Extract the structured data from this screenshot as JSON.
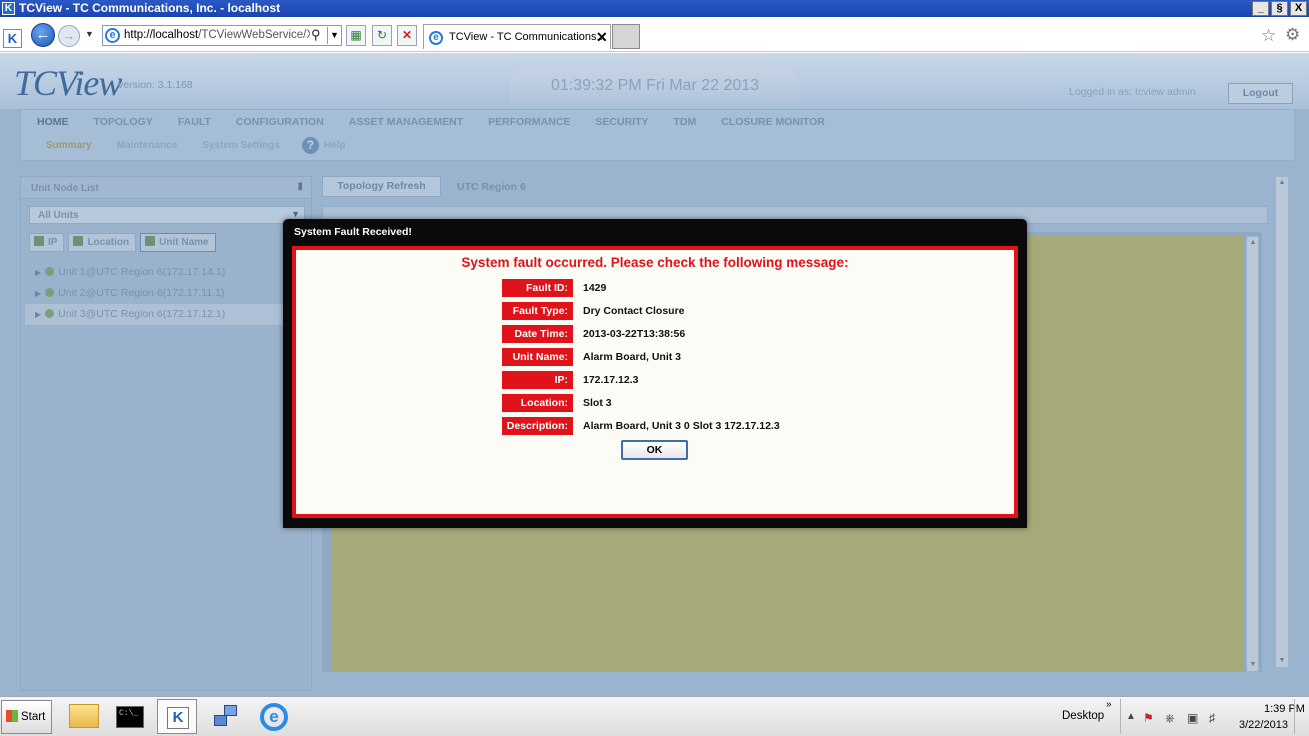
{
  "window": {
    "title": "TCView - TC Communications, Inc. - localhost",
    "buttons": [
      "_",
      "§",
      "X"
    ]
  },
  "browser": {
    "url_host": "http://localhost",
    "url_path": "/TCViewWebService/XML",
    "tab_title": "TCView - TC Communications...",
    "tab_close": "✕"
  },
  "app": {
    "logo": "TCView",
    "version": "version: 3.1.168",
    "clock": "01:39:32 PM  Fri Mar 22 2013",
    "logged_in": "Logged in as: tcview admin",
    "logout": "Logout",
    "main_nav": [
      "HOME",
      "TOPOLOGY",
      "FAULT",
      "CONFIGURATION",
      "ASSET MANAGEMENT",
      "PERFORMANCE",
      "SECURITY",
      "TDM",
      "CLOSURE MONITOR"
    ],
    "sub_nav": [
      "Summary",
      "Maintenance",
      "System Settings"
    ],
    "help": "Help",
    "left_panel": {
      "title": "Unit Node List",
      "select_value": "All Units",
      "buttons": [
        "IP",
        "Location",
        "Unit Name"
      ],
      "tree": [
        "Unit 1@UTC Region 6(172.17.14.1)",
        "Unit 2@UTC Region 6(172.17.11.1)",
        "Unit 3@UTC Region 6(172.17.12.1)"
      ]
    },
    "topology_refresh": "Topology Refresh",
    "region": "UTC Region 6"
  },
  "dialog": {
    "title": "System Fault Received!",
    "heading": "System fault occurred.  Please check the following message:",
    "fields": [
      {
        "label": "Fault ID:",
        "value": "1429"
      },
      {
        "label": "Fault Type:",
        "value": "Dry Contact Closure"
      },
      {
        "label": "Date Time:",
        "value": "2013-03-22T13:38:56"
      },
      {
        "label": "Unit Name:",
        "value": "Alarm Board, Unit 3"
      },
      {
        "label": "IP:",
        "value": "172.17.12.3"
      },
      {
        "label": "Location:",
        "value": "Slot 3"
      },
      {
        "label": "Description:",
        "value": "Alarm Board, Unit 3 0 Slot 3 172.17.12.3"
      }
    ],
    "ok": "OK"
  },
  "taskbar": {
    "start": "Start",
    "cmd_text": "C:\\_",
    "desktop": "Desktop",
    "time": "1:39 PM",
    "date": "3/22/2013"
  },
  "colors": {
    "alert_red": "#e0121a",
    "app_dimmed": "#9ab3cf",
    "olive": "#a6aa78"
  }
}
